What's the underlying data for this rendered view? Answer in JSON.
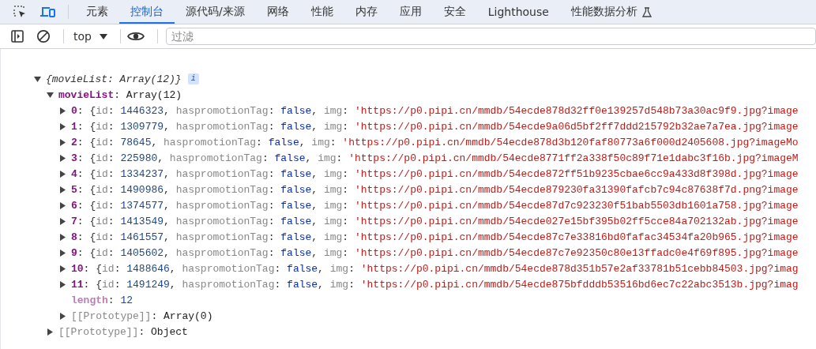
{
  "tabs": [
    {
      "label": "元素",
      "selected": false
    },
    {
      "label": "控制台",
      "selected": true
    },
    {
      "label": "源代码/来源",
      "selected": false
    },
    {
      "label": "网络",
      "selected": false
    },
    {
      "label": "性能",
      "selected": false
    },
    {
      "label": "内存",
      "selected": false
    },
    {
      "label": "应用",
      "selected": false
    },
    {
      "label": "安全",
      "selected": false
    },
    {
      "label": "Lighthouse",
      "selected": false
    },
    {
      "label": "性能数据分析",
      "selected": false,
      "experimental": true
    }
  ],
  "toolbar": {
    "context": "top",
    "filter": {
      "placeholder": "过滤"
    }
  },
  "console": [
    {
      "summary": "{movieList: Array(12)}",
      "expanded": true,
      "badge": "i",
      "children": [
        {
          "expanded": true,
          "parts": [
            {
              "text": "movieList",
              "kind": "key"
            },
            {
              "text": ": ",
              "kind": "punct"
            },
            {
              "text": "Array(12)",
              "kind": "plain"
            }
          ],
          "children": [
            {
              "expanded": false,
              "parts": [
                {
                  "text": "0",
                  "kind": "key"
                },
                {
                  "text": ": {",
                  "kind": "punct"
                },
                {
                  "text": "id",
                  "kind": "field"
                },
                {
                  "text": ": ",
                  "kind": "punct"
                },
                {
                  "text": "1446323",
                  "kind": "number"
                },
                {
                  "text": ", ",
                  "kind": "punct"
                },
                {
                  "text": "haspromotionTag",
                  "kind": "field"
                },
                {
                  "text": ": ",
                  "kind": "punct"
                },
                {
                  "text": "false",
                  "kind": "boolean"
                },
                {
                  "text": ", ",
                  "kind": "punct"
                },
                {
                  "text": "img",
                  "kind": "field"
                },
                {
                  "text": ": ",
                  "kind": "punct"
                },
                {
                  "text": "'https://p0.pipi.cn/mmdb/54ecde878d32ff0e139257d548b73a30ac9f9.jpg?image",
                  "kind": "string"
                }
              ]
            },
            {
              "expanded": false,
              "parts": [
                {
                  "text": "1",
                  "kind": "key"
                },
                {
                  "text": ": {",
                  "kind": "punct"
                },
                {
                  "text": "id",
                  "kind": "field"
                },
                {
                  "text": ": ",
                  "kind": "punct"
                },
                {
                  "text": "1309779",
                  "kind": "number"
                },
                {
                  "text": ", ",
                  "kind": "punct"
                },
                {
                  "text": "haspromotionTag",
                  "kind": "field"
                },
                {
                  "text": ": ",
                  "kind": "punct"
                },
                {
                  "text": "false",
                  "kind": "boolean"
                },
                {
                  "text": ", ",
                  "kind": "punct"
                },
                {
                  "text": "img",
                  "kind": "field"
                },
                {
                  "text": ": ",
                  "kind": "punct"
                },
                {
                  "text": "'https://p0.pipi.cn/mmdb/54ecde9a06d5bf2ff7ddd215792b32ae7a7ea.jpg?image",
                  "kind": "string"
                }
              ]
            },
            {
              "expanded": false,
              "parts": [
                {
                  "text": "2",
                  "kind": "key"
                },
                {
                  "text": ": {",
                  "kind": "punct"
                },
                {
                  "text": "id",
                  "kind": "field"
                },
                {
                  "text": ": ",
                  "kind": "punct"
                },
                {
                  "text": "78645",
                  "kind": "number"
                },
                {
                  "text": ", ",
                  "kind": "punct"
                },
                {
                  "text": "haspromotionTag",
                  "kind": "field"
                },
                {
                  "text": ": ",
                  "kind": "punct"
                },
                {
                  "text": "false",
                  "kind": "boolean"
                },
                {
                  "text": ", ",
                  "kind": "punct"
                },
                {
                  "text": "img",
                  "kind": "field"
                },
                {
                  "text": ": ",
                  "kind": "punct"
                },
                {
                  "text": "'https://p0.pipi.cn/mmdb/54ecde878d3b120faf80773a6f000d2405608.jpg?imageMo",
                  "kind": "string"
                }
              ]
            },
            {
              "expanded": false,
              "parts": [
                {
                  "text": "3",
                  "kind": "key"
                },
                {
                  "text": ": {",
                  "kind": "punct"
                },
                {
                  "text": "id",
                  "kind": "field"
                },
                {
                  "text": ": ",
                  "kind": "punct"
                },
                {
                  "text": "225980",
                  "kind": "number"
                },
                {
                  "text": ", ",
                  "kind": "punct"
                },
                {
                  "text": "haspromotionTag",
                  "kind": "field"
                },
                {
                  "text": ": ",
                  "kind": "punct"
                },
                {
                  "text": "false",
                  "kind": "boolean"
                },
                {
                  "text": ", ",
                  "kind": "punct"
                },
                {
                  "text": "img",
                  "kind": "field"
                },
                {
                  "text": ": ",
                  "kind": "punct"
                },
                {
                  "text": "'https://p0.pipi.cn/mmdb/54ecde8771ff2a338f50c89f71e1dabc3f16b.jpg?imageM",
                  "kind": "string"
                }
              ]
            },
            {
              "expanded": false,
              "parts": [
                {
                  "text": "4",
                  "kind": "key"
                },
                {
                  "text": ": {",
                  "kind": "punct"
                },
                {
                  "text": "id",
                  "kind": "field"
                },
                {
                  "text": ": ",
                  "kind": "punct"
                },
                {
                  "text": "1334237",
                  "kind": "number"
                },
                {
                  "text": ", ",
                  "kind": "punct"
                },
                {
                  "text": "haspromotionTag",
                  "kind": "field"
                },
                {
                  "text": ": ",
                  "kind": "punct"
                },
                {
                  "text": "false",
                  "kind": "boolean"
                },
                {
                  "text": ", ",
                  "kind": "punct"
                },
                {
                  "text": "img",
                  "kind": "field"
                },
                {
                  "text": ": ",
                  "kind": "punct"
                },
                {
                  "text": "'https://p0.pipi.cn/mmdb/54ecde872ff51b9235cbae6cc9a433d8f398d.jpg?image",
                  "kind": "string"
                }
              ]
            },
            {
              "expanded": false,
              "parts": [
                {
                  "text": "5",
                  "kind": "key"
                },
                {
                  "text": ": {",
                  "kind": "punct"
                },
                {
                  "text": "id",
                  "kind": "field"
                },
                {
                  "text": ": ",
                  "kind": "punct"
                },
                {
                  "text": "1490986",
                  "kind": "number"
                },
                {
                  "text": ", ",
                  "kind": "punct"
                },
                {
                  "text": "haspromotionTag",
                  "kind": "field"
                },
                {
                  "text": ": ",
                  "kind": "punct"
                },
                {
                  "text": "false",
                  "kind": "boolean"
                },
                {
                  "text": ", ",
                  "kind": "punct"
                },
                {
                  "text": "img",
                  "kind": "field"
                },
                {
                  "text": ": ",
                  "kind": "punct"
                },
                {
                  "text": "'https://p0.pipi.cn/mmdb/54ecde879230fa31390fafcb7c94c87638f7d.png?image",
                  "kind": "string"
                }
              ]
            },
            {
              "expanded": false,
              "parts": [
                {
                  "text": "6",
                  "kind": "key"
                },
                {
                  "text": ": {",
                  "kind": "punct"
                },
                {
                  "text": "id",
                  "kind": "field"
                },
                {
                  "text": ": ",
                  "kind": "punct"
                },
                {
                  "text": "1374577",
                  "kind": "number"
                },
                {
                  "text": ", ",
                  "kind": "punct"
                },
                {
                  "text": "haspromotionTag",
                  "kind": "field"
                },
                {
                  "text": ": ",
                  "kind": "punct"
                },
                {
                  "text": "false",
                  "kind": "boolean"
                },
                {
                  "text": ", ",
                  "kind": "punct"
                },
                {
                  "text": "img",
                  "kind": "field"
                },
                {
                  "text": ": ",
                  "kind": "punct"
                },
                {
                  "text": "'https://p0.pipi.cn/mmdb/54ecde87d7c923230f51bab5503db1601a758.jpg?image",
                  "kind": "string"
                }
              ]
            },
            {
              "expanded": false,
              "parts": [
                {
                  "text": "7",
                  "kind": "key"
                },
                {
                  "text": ": {",
                  "kind": "punct"
                },
                {
                  "text": "id",
                  "kind": "field"
                },
                {
                  "text": ": ",
                  "kind": "punct"
                },
                {
                  "text": "1413549",
                  "kind": "number"
                },
                {
                  "text": ", ",
                  "kind": "punct"
                },
                {
                  "text": "haspromotionTag",
                  "kind": "field"
                },
                {
                  "text": ": ",
                  "kind": "punct"
                },
                {
                  "text": "false",
                  "kind": "boolean"
                },
                {
                  "text": ", ",
                  "kind": "punct"
                },
                {
                  "text": "img",
                  "kind": "field"
                },
                {
                  "text": ": ",
                  "kind": "punct"
                },
                {
                  "text": "'https://p0.pipi.cn/mmdb/54ecde027e15bf395b02ff5cce84a702132ab.jpg?image",
                  "kind": "string"
                }
              ]
            },
            {
              "expanded": false,
              "parts": [
                {
                  "text": "8",
                  "kind": "key"
                },
                {
                  "text": ": {",
                  "kind": "punct"
                },
                {
                  "text": "id",
                  "kind": "field"
                },
                {
                  "text": ": ",
                  "kind": "punct"
                },
                {
                  "text": "1461557",
                  "kind": "number"
                },
                {
                  "text": ", ",
                  "kind": "punct"
                },
                {
                  "text": "haspromotionTag",
                  "kind": "field"
                },
                {
                  "text": ": ",
                  "kind": "punct"
                },
                {
                  "text": "false",
                  "kind": "boolean"
                },
                {
                  "text": ", ",
                  "kind": "punct"
                },
                {
                  "text": "img",
                  "kind": "field"
                },
                {
                  "text": ": ",
                  "kind": "punct"
                },
                {
                  "text": "'https://p0.pipi.cn/mmdb/54ecde87c7e33816bd0fafac34534fa20b965.jpg?image",
                  "kind": "string"
                }
              ]
            },
            {
              "expanded": false,
              "parts": [
                {
                  "text": "9",
                  "kind": "key"
                },
                {
                  "text": ": {",
                  "kind": "punct"
                },
                {
                  "text": "id",
                  "kind": "field"
                },
                {
                  "text": ": ",
                  "kind": "punct"
                },
                {
                  "text": "1405602",
                  "kind": "number"
                },
                {
                  "text": ", ",
                  "kind": "punct"
                },
                {
                  "text": "haspromotionTag",
                  "kind": "field"
                },
                {
                  "text": ": ",
                  "kind": "punct"
                },
                {
                  "text": "false",
                  "kind": "boolean"
                },
                {
                  "text": ", ",
                  "kind": "punct"
                },
                {
                  "text": "img",
                  "kind": "field"
                },
                {
                  "text": ": ",
                  "kind": "punct"
                },
                {
                  "text": "'https://p0.pipi.cn/mmdb/54ecde87c7e92350c80e13ffadc0e4f69f895.jpg?image",
                  "kind": "string"
                }
              ]
            },
            {
              "expanded": false,
              "parts": [
                {
                  "text": "10",
                  "kind": "key"
                },
                {
                  "text": ": {",
                  "kind": "punct"
                },
                {
                  "text": "id",
                  "kind": "field"
                },
                {
                  "text": ": ",
                  "kind": "punct"
                },
                {
                  "text": "1488646",
                  "kind": "number"
                },
                {
                  "text": ", ",
                  "kind": "punct"
                },
                {
                  "text": "haspromotionTag",
                  "kind": "field"
                },
                {
                  "text": ": ",
                  "kind": "punct"
                },
                {
                  "text": "false",
                  "kind": "boolean"
                },
                {
                  "text": ", ",
                  "kind": "punct"
                },
                {
                  "text": "img",
                  "kind": "field"
                },
                {
                  "text": ": ",
                  "kind": "punct"
                },
                {
                  "text": "'https://p0.pipi.cn/mmdb/54ecde878d351b57e2af33781b51cebb84503.jpg?imag",
                  "kind": "string"
                }
              ]
            },
            {
              "expanded": false,
              "parts": [
                {
                  "text": "11",
                  "kind": "key"
                },
                {
                  "text": ": {",
                  "kind": "punct"
                },
                {
                  "text": "id",
                  "kind": "field"
                },
                {
                  "text": ": ",
                  "kind": "punct"
                },
                {
                  "text": "1491249",
                  "kind": "number"
                },
                {
                  "text": ", ",
                  "kind": "punct"
                },
                {
                  "text": "haspromotionTag",
                  "kind": "field"
                },
                {
                  "text": ": ",
                  "kind": "punct"
                },
                {
                  "text": "false",
                  "kind": "boolean"
                },
                {
                  "text": ", ",
                  "kind": "punct"
                },
                {
                  "text": "img",
                  "kind": "field"
                },
                {
                  "text": ": ",
                  "kind": "punct"
                },
                {
                  "text": "'https://p0.pipi.cn/mmdb/54ecde875bfdddb53516bd6ec7c22abc3513b.jpg?imag",
                  "kind": "string"
                }
              ]
            },
            {
              "parts": [
                {
                  "text": "length",
                  "kind": "hidden"
                },
                {
                  "text": ": ",
                  "kind": "punct"
                },
                {
                  "text": "12",
                  "kind": "number"
                }
              ]
            },
            {
              "expanded": false,
              "parts": [
                {
                  "text": "[[Prototype]]",
                  "kind": "internal"
                },
                {
                  "text": ": ",
                  "kind": "punct"
                },
                {
                  "text": "Array(0)",
                  "kind": "plain"
                }
              ]
            }
          ]
        },
        {
          "expanded": false,
          "parts": [
            {
              "text": "[[Prototype]]",
              "kind": "internal"
            },
            {
              "text": ": ",
              "kind": "punct"
            },
            {
              "text": "Object",
              "kind": "plain"
            }
          ]
        }
      ]
    }
  ]
}
